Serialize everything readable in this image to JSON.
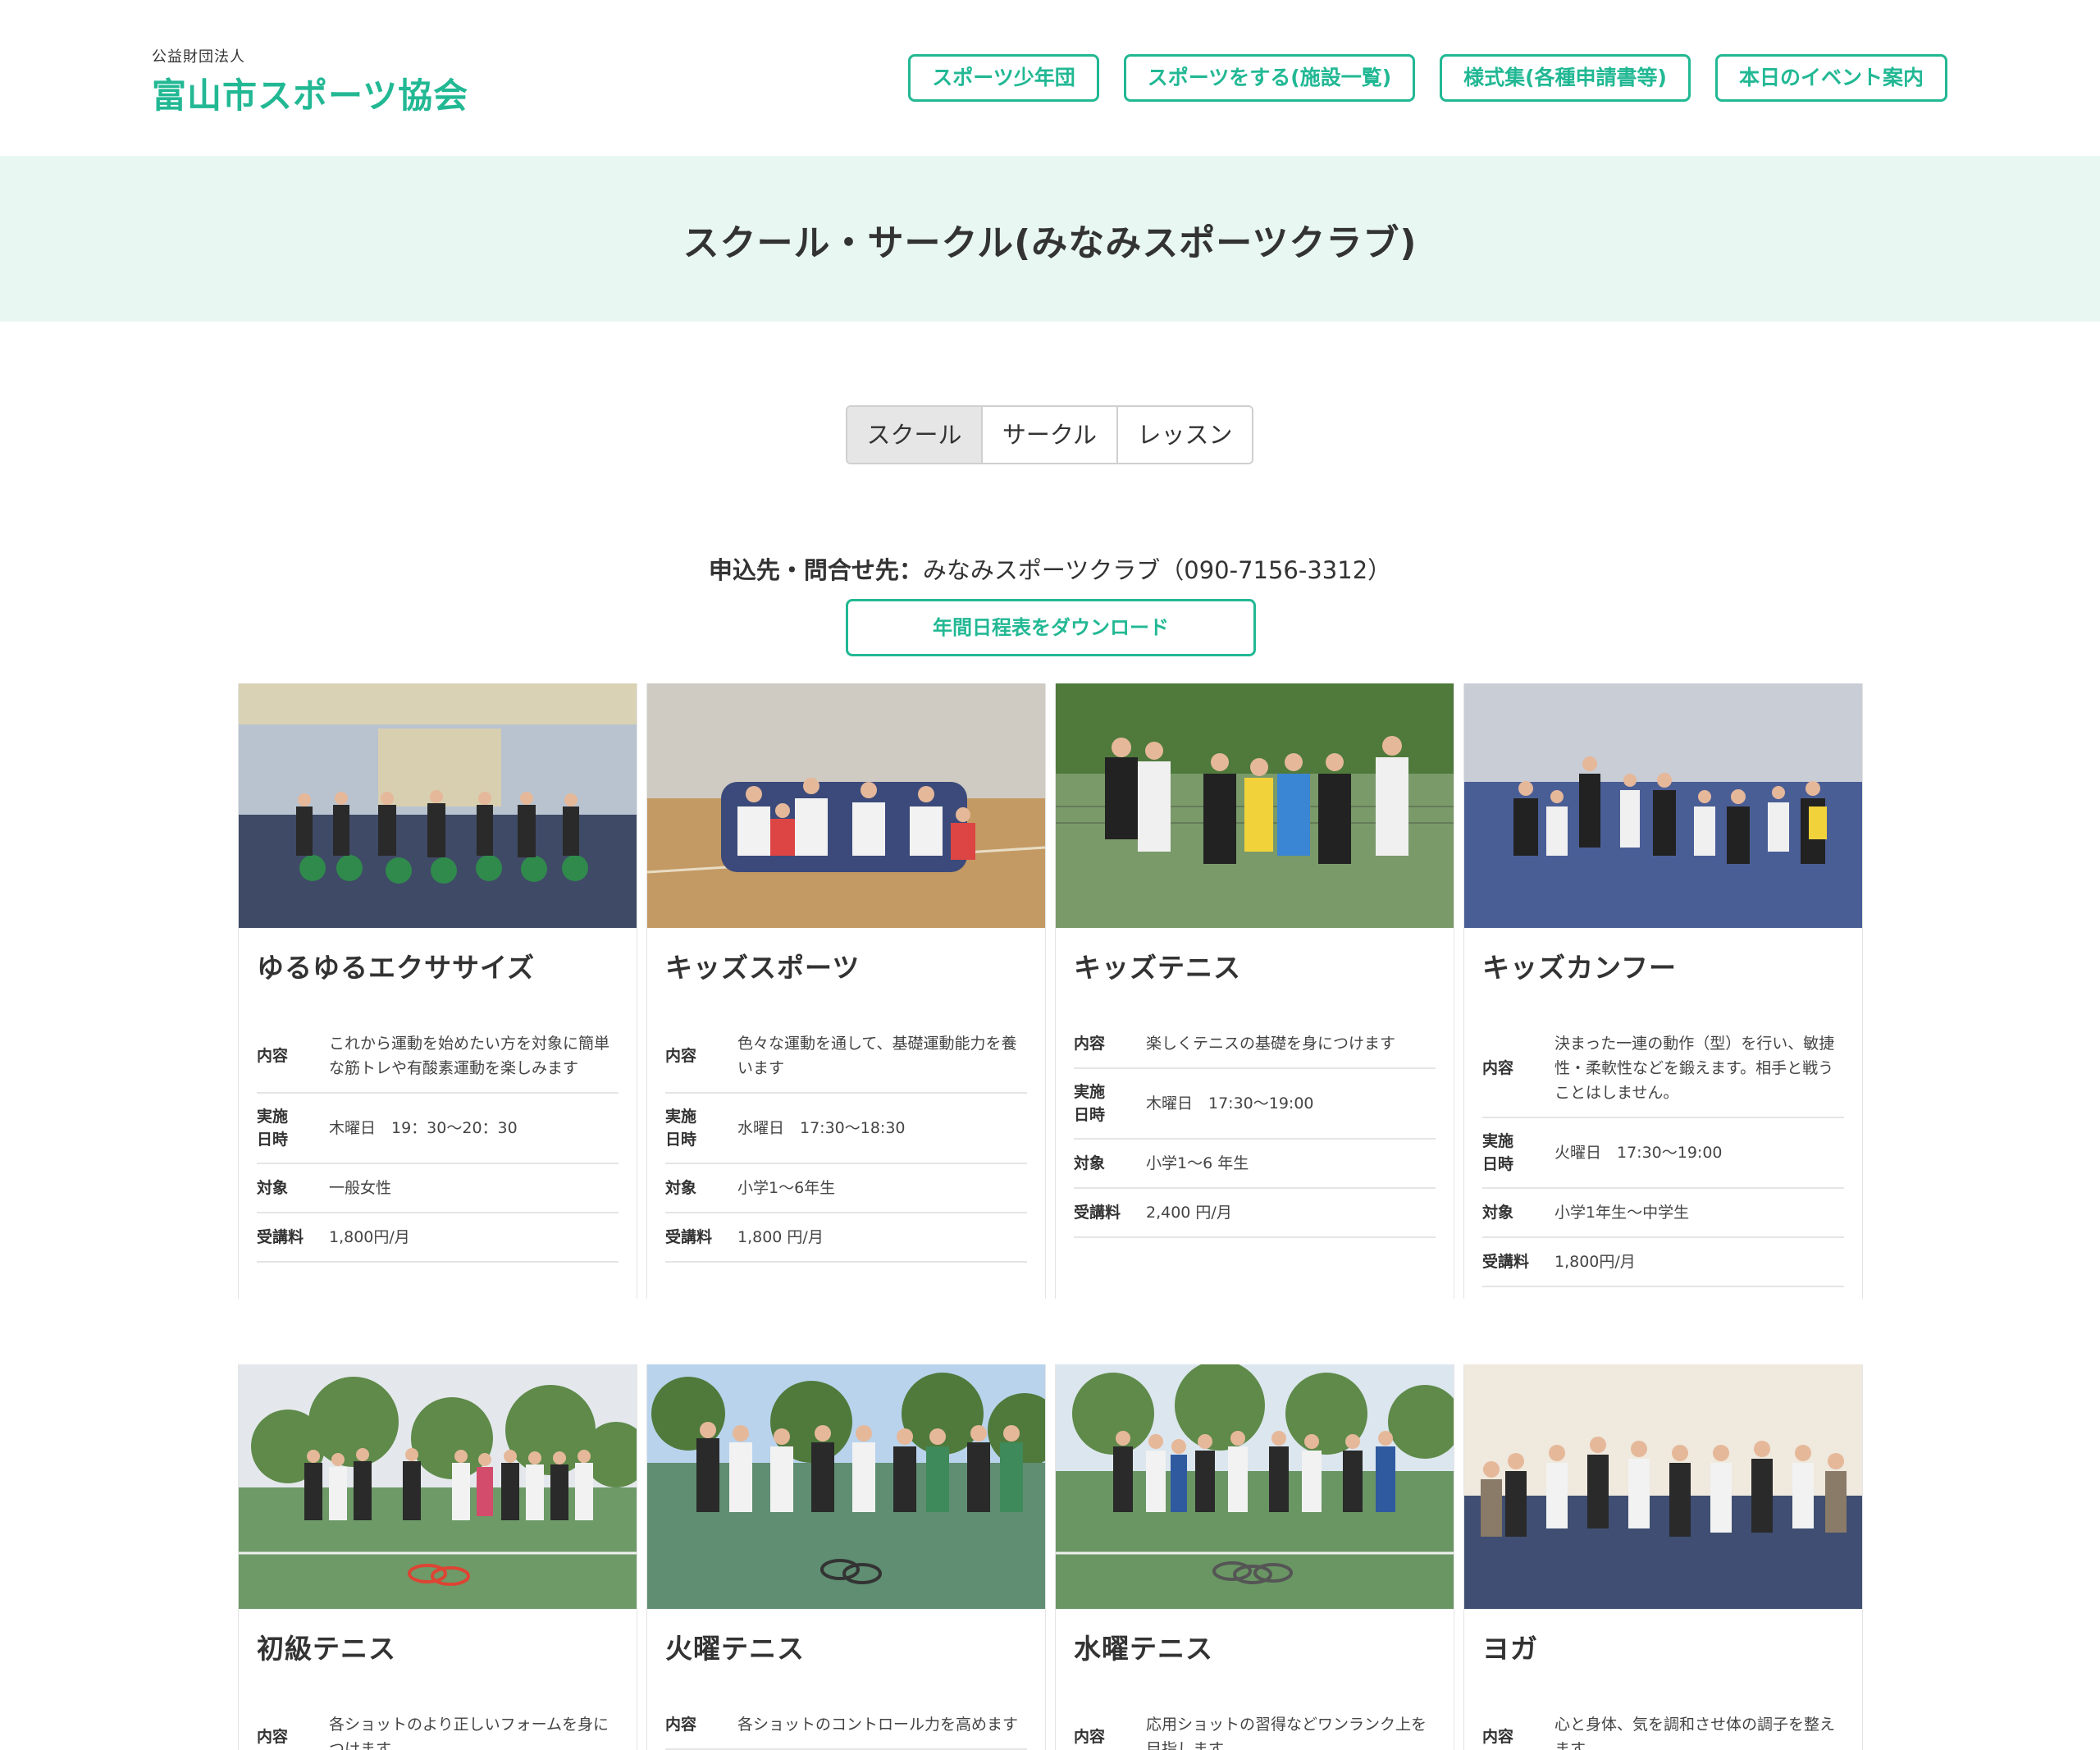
{
  "header": {
    "logo_sub": "公益財団法人",
    "logo_main": "富山市スポーツ協会",
    "nav": [
      "スポーツ少年団",
      "スポーツをする(施設一覧)",
      "様式集(各種申請書等)",
      "本日のイベント案内"
    ]
  },
  "page": {
    "title": "スクール・サークル(みなみスポーツクラブ)"
  },
  "tabs": [
    "スクール",
    "サークル",
    "レッスン"
  ],
  "contact": {
    "label": "申込先・問合せ先：",
    "value": "みなみスポーツクラブ（090-7156-3312）"
  },
  "download_label": "年間日程表をダウンロード",
  "labels": {
    "content": "内容",
    "date1": "実施",
    "date2": "日時",
    "target": "対象",
    "fee": "受講料"
  },
  "cards": [
    {
      "title": "ゆるゆるエクササイズ",
      "content": "これから運動を始めたい方を対象に簡単な筋トレや有酸素運動を楽しみます",
      "schedule": "木曜日　19：30〜20：30",
      "target": "一般女性",
      "fee": "1,800円/月"
    },
    {
      "title": "キッズスポーツ",
      "content": "色々な運動を通して、基礎運動能力を養います",
      "schedule": "水曜日　17:30〜18:30",
      "target": "小学1～6年生",
      "fee": "1,800 円/月"
    },
    {
      "title": "キッズテニス",
      "content": "楽しくテニスの基礎を身につけます",
      "schedule": "木曜日　17:30〜19:00",
      "target": "小学1～6 年生",
      "fee": "2,400 円/月"
    },
    {
      "title": "キッズカンフー",
      "content": "決まった一連の動作（型）を行い、敏捷性・柔軟性などを鍛えます。相手と戦うことはしません。",
      "schedule": "火曜日　17:30〜19:00",
      "target": "小学1年生〜中学生",
      "fee": "1,800円/月"
    },
    {
      "title": "初級テニス",
      "content": "各ショットのより正しいフォームを身につけます"
    },
    {
      "title": "火曜テニス",
      "content": "各ショットのコントロール力を高めます"
    },
    {
      "title": "水曜テニス",
      "content": "応用ショットの習得などワンランク上を目指します"
    },
    {
      "title": "ヨガ",
      "content": "心と身体、気を調和させ体の調子を整えます"
    }
  ]
}
